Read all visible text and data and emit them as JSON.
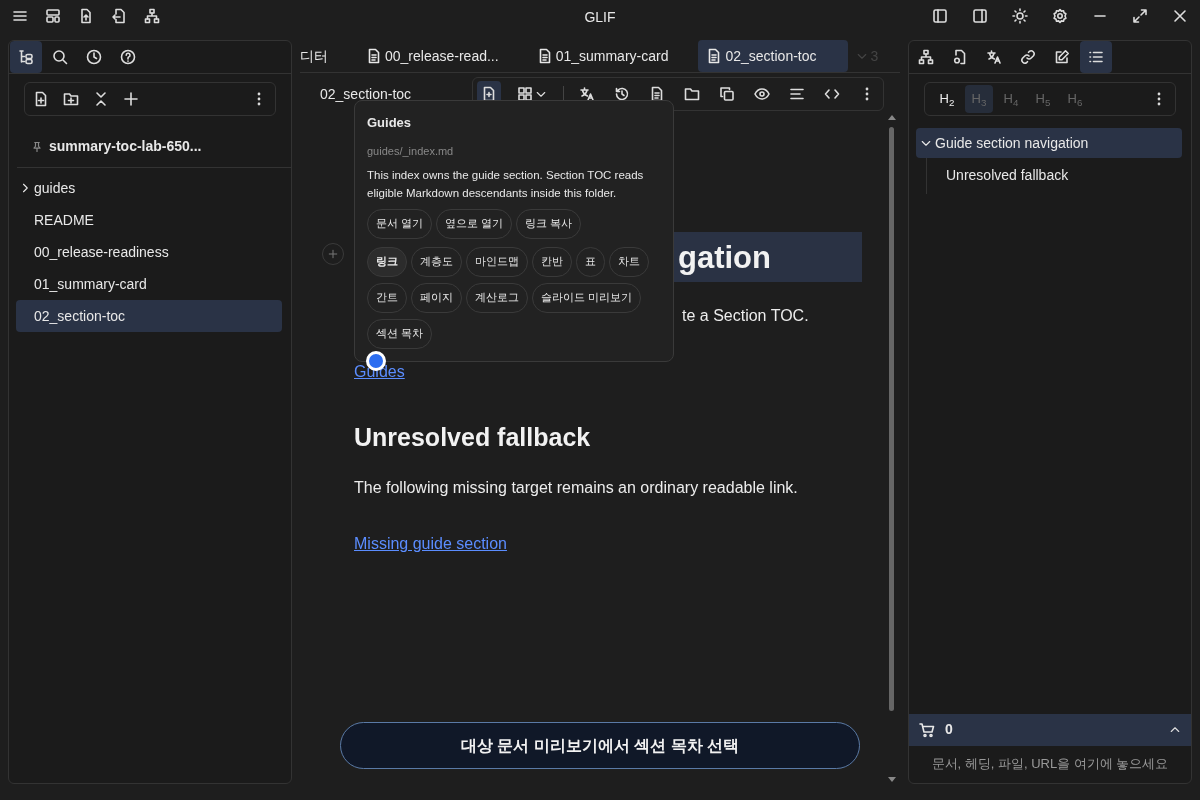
{
  "window": {
    "title": "GLIF"
  },
  "left_panel": {
    "tabs": [
      {
        "selected": true
      },
      {
        "selected": false
      },
      {
        "selected": false
      },
      {
        "selected": false
      }
    ],
    "project": "summary-toc-lab-650...",
    "tree": [
      {
        "label": "guides",
        "expanded": false,
        "selected": false
      },
      {
        "label": "README",
        "selected": false
      },
      {
        "label": "00_release-readiness",
        "selected": false
      },
      {
        "label": "01_summary-card",
        "selected": false
      },
      {
        "label": "02_section-toc",
        "selected": true
      }
    ]
  },
  "editor_tabs": [
    {
      "label": "디터",
      "kind": "plain",
      "selected": false
    },
    {
      "label": "00_release-read...",
      "kind": "doc",
      "selected": false
    },
    {
      "label": "01_summary-card",
      "kind": "doc",
      "selected": false
    },
    {
      "label": "02_section-toc",
      "kind": "doc",
      "selected": true
    }
  ],
  "tab_overflow": "3",
  "doc_title": "02_section-toc",
  "editor_tools": [
    {
      "selected": true
    },
    {
      "selected": false
    }
  ],
  "content": [
    {
      "kind": "heading2",
      "text": "gation",
      "selected": true
    },
    {
      "kind": "paragraph",
      "text": "te a Section TOC."
    },
    {
      "kind": "link",
      "text": "Guides"
    },
    {
      "kind": "heading3",
      "text": "Unresolved fallback"
    },
    {
      "kind": "paragraph",
      "text": "The following missing target remains an ordinary readable link."
    },
    {
      "kind": "link",
      "text": "Missing guide section"
    }
  ],
  "popover": {
    "title": "Guides",
    "path": "guides/_index.md",
    "description": "This index owns the guide section. Section TOC reads eligible Markdown descendants inside this folder.",
    "actions": [
      "문서 열기",
      "옆으로 열기",
      "링크 복사"
    ],
    "views": [
      {
        "label": "링크",
        "selected": true
      },
      {
        "label": "계층도",
        "selected": false
      },
      {
        "label": "마인드맵",
        "selected": false
      },
      {
        "label": "칸반",
        "selected": false
      },
      {
        "label": "표",
        "selected": false
      },
      {
        "label": "차트",
        "selected": false
      },
      {
        "label": "간트",
        "selected": false
      },
      {
        "label": "페이지",
        "selected": false
      },
      {
        "label": "계산로그",
        "selected": false
      },
      {
        "label": "슬라이드 미리보기",
        "selected": false
      },
      {
        "label": "섹션 목차",
        "selected": false
      }
    ]
  },
  "action_button": "대상 문서 미리보기에서 섹션 목차 선택",
  "right_panel": {
    "tabs": [
      {
        "selected": false
      },
      {
        "selected": false
      },
      {
        "selected": false
      },
      {
        "selected": false
      },
      {
        "selected": false
      },
      {
        "selected": true
      }
    ],
    "heading_levels": [
      {
        "label": "H$_{2}$",
        "enabled": true,
        "selected": false
      },
      {
        "label": "H$_{3}$",
        "enabled": false,
        "selected": true
      },
      {
        "label": "H$_{4}$",
        "enabled": false,
        "selected": false
      },
      {
        "label": "H$_{5}$",
        "enabled": false,
        "selected": false
      },
      {
        "label": "H$_{6}$",
        "enabled": false,
        "selected": false
      }
    ],
    "toc": [
      {
        "label": "Guide section navigation",
        "expanded": true,
        "selected": true,
        "children": [
          {
            "label": "Unresolved fallback",
            "selected": false
          }
        ]
      }
    ],
    "basket": {
      "count": "0",
      "expanded": false
    },
    "drop_hint": "문서, 헤딩, 파일, URL을 여기에 놓으세요"
  }
}
